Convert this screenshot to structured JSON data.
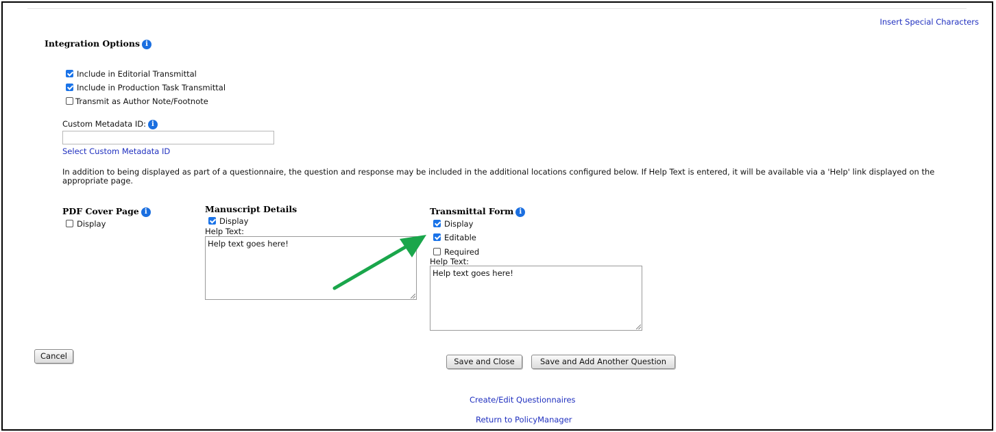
{
  "header": {
    "insert_special_chars": "Insert Special Characters"
  },
  "integration": {
    "title": "Integration Options",
    "options": [
      {
        "label": "Include in Editorial Transmittal",
        "checked": true
      },
      {
        "label": "Include in Production Task Transmittal",
        "checked": true
      },
      {
        "label": "Transmit as Author Note/Footnote",
        "checked": false
      }
    ],
    "custom_metadata_label": "Custom Metadata ID:",
    "custom_metadata_value": "",
    "select_custom_metadata": "Select Custom Metadata ID",
    "description": "In addition to being displayed as part of a questionnaire, the question and response may be included in the additional locations configured below. If Help Text is entered, it will be available via a 'Help' link displayed on the appropriate page."
  },
  "pdf_cover": {
    "title": "PDF Cover Page",
    "display_label": "Display",
    "display_checked": false
  },
  "manuscript_details": {
    "title": "Manuscript Details",
    "display_label": "Display",
    "display_checked": true,
    "help_text_label": "Help Text:",
    "help_text_value": "Help text goes here!"
  },
  "transmittal_form": {
    "title": "Transmittal Form",
    "display_label": "Display",
    "display_checked": true,
    "editable_label": "Editable",
    "editable_checked": true,
    "required_label": "Required",
    "required_checked": false,
    "help_text_label": "Help Text:",
    "help_text_value": "Help text goes here!"
  },
  "annotation": {
    "arrow_color": "#1aa64b"
  },
  "buttons": {
    "cancel": "Cancel",
    "save_close": "Save and Close",
    "save_add": "Save and Add Another Question"
  },
  "footer_links": {
    "create_edit": "Create/Edit Questionnaires",
    "return": "Return to PolicyManager"
  }
}
